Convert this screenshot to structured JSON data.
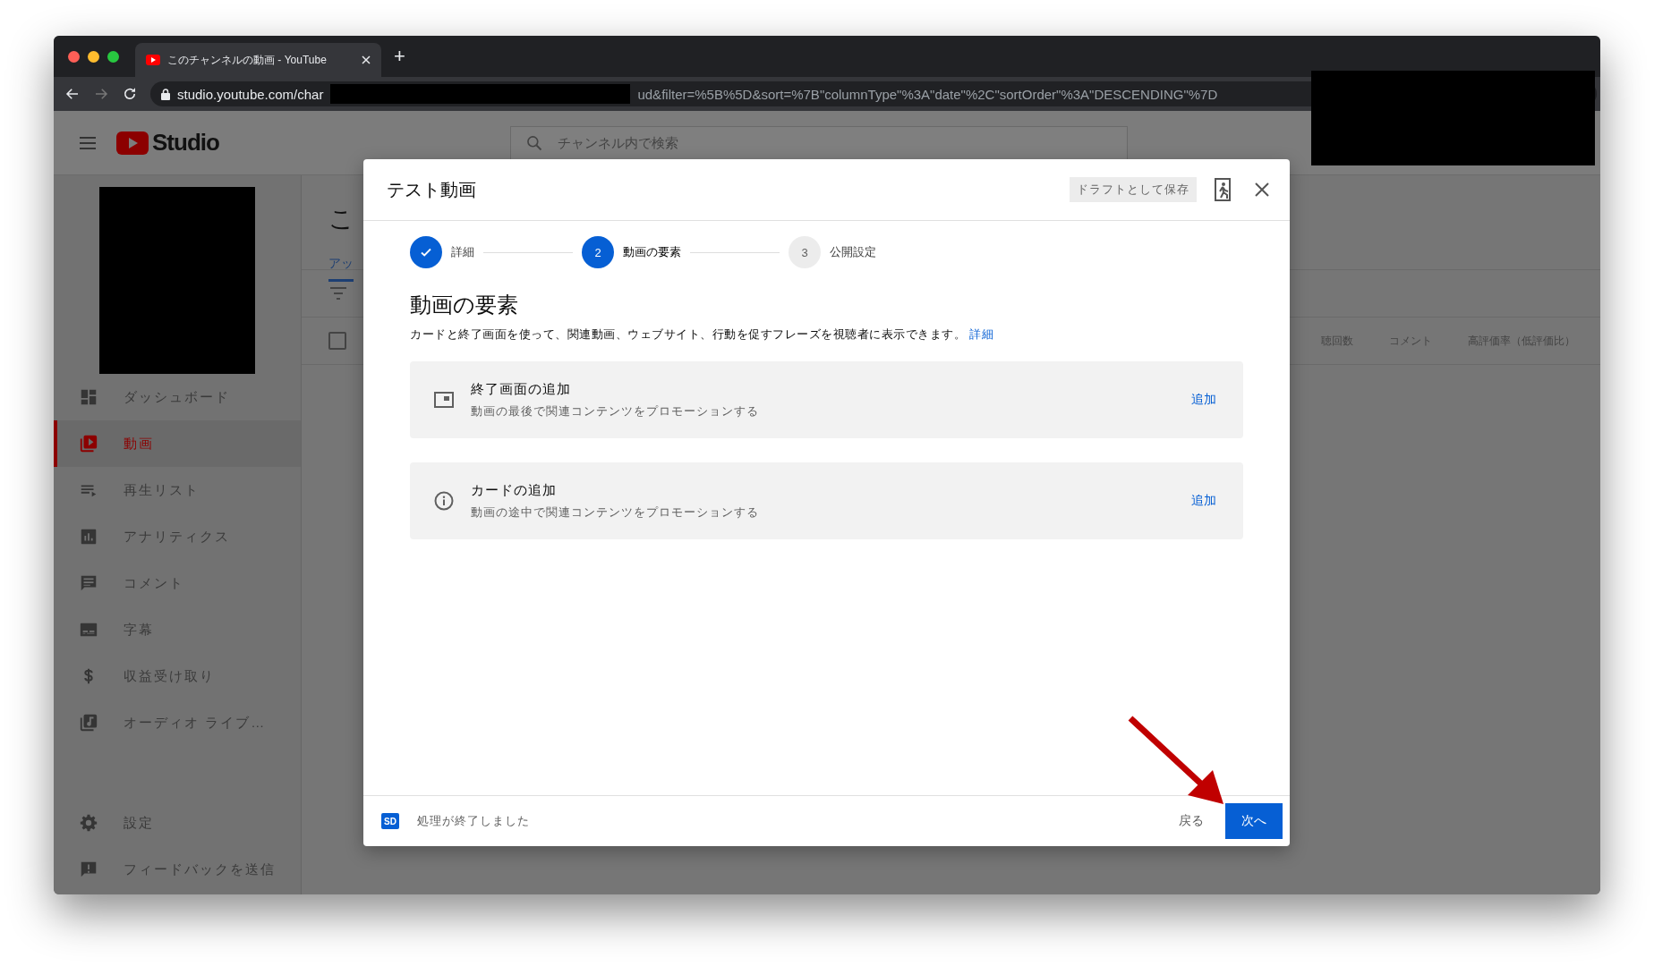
{
  "browser": {
    "tab_title": "このチャンネルの動画 - YouTube",
    "new_tab": "+",
    "url_start": "studio.youtube.com/char",
    "url_end": "ud&filter=%5B%5D&sort=%7B\"columnType\"%3A\"date\"%2C\"sortOrder\"%3A\"DESCENDING\"%7D"
  },
  "app_header": {
    "logo_text": "Studio",
    "search": {
      "placeholder": "チャンネル内で検索"
    }
  },
  "sidebar": {
    "items": [
      {
        "kind": "dashboard",
        "label": "ダッシュボード",
        "selected": false
      },
      {
        "kind": "videos",
        "label": "動画",
        "selected": true
      },
      {
        "kind": "playlist",
        "label": "再生リスト",
        "selected": false
      },
      {
        "kind": "analytics",
        "label": "アナリティクス",
        "selected": false
      },
      {
        "kind": "comments",
        "label": "コメント",
        "selected": false
      },
      {
        "kind": "subtitles",
        "label": "字幕",
        "selected": false
      },
      {
        "kind": "money",
        "label": "収益受け取り",
        "selected": false
      },
      {
        "kind": "audio",
        "label": "オーディオ ライブ…",
        "selected": false
      }
    ],
    "footer_items": [
      {
        "kind": "settings",
        "label": "設定",
        "selected": false
      },
      {
        "kind": "feedback",
        "label": "フィードバックを送信",
        "selected": false
      }
    ]
  },
  "page": {
    "title": "こ",
    "tab": "アッ",
    "select_all": {
      "checked": false
    },
    "columns": [
      "聴回数",
      "コメント",
      "高評価率（低評価比）"
    ]
  },
  "dialog": {
    "title": "テスト動画",
    "draft_button": "ドラフトとして保存",
    "steps": [
      {
        "label": "詳細",
        "completed": true,
        "selected": false
      },
      {
        "number": "2",
        "label": "動画の要素",
        "completed": false,
        "selected": true
      },
      {
        "number": "3",
        "label": "公開設定",
        "completed": false,
        "selected": false
      }
    ],
    "heading": "動画の要素",
    "description": "カードと終了画面を使って、関連動画、ウェブサイト、行動を促すフレーズを視聴者に表示できます。",
    "description_link": "詳細",
    "cards": [
      {
        "kind": "end-screen",
        "title": "終了画面の追加",
        "subtitle": "動画の最後で関連コンテンツをプロモーションする",
        "action": "追加"
      },
      {
        "kind": "info",
        "title": "カードの追加",
        "subtitle": "動画の途中で関連コンテンツをプロモーションする",
        "action": "追加"
      }
    ],
    "footer": {
      "badge": "SD",
      "status": "処理が終了しました",
      "back": "戻る",
      "next": "次へ"
    }
  }
}
